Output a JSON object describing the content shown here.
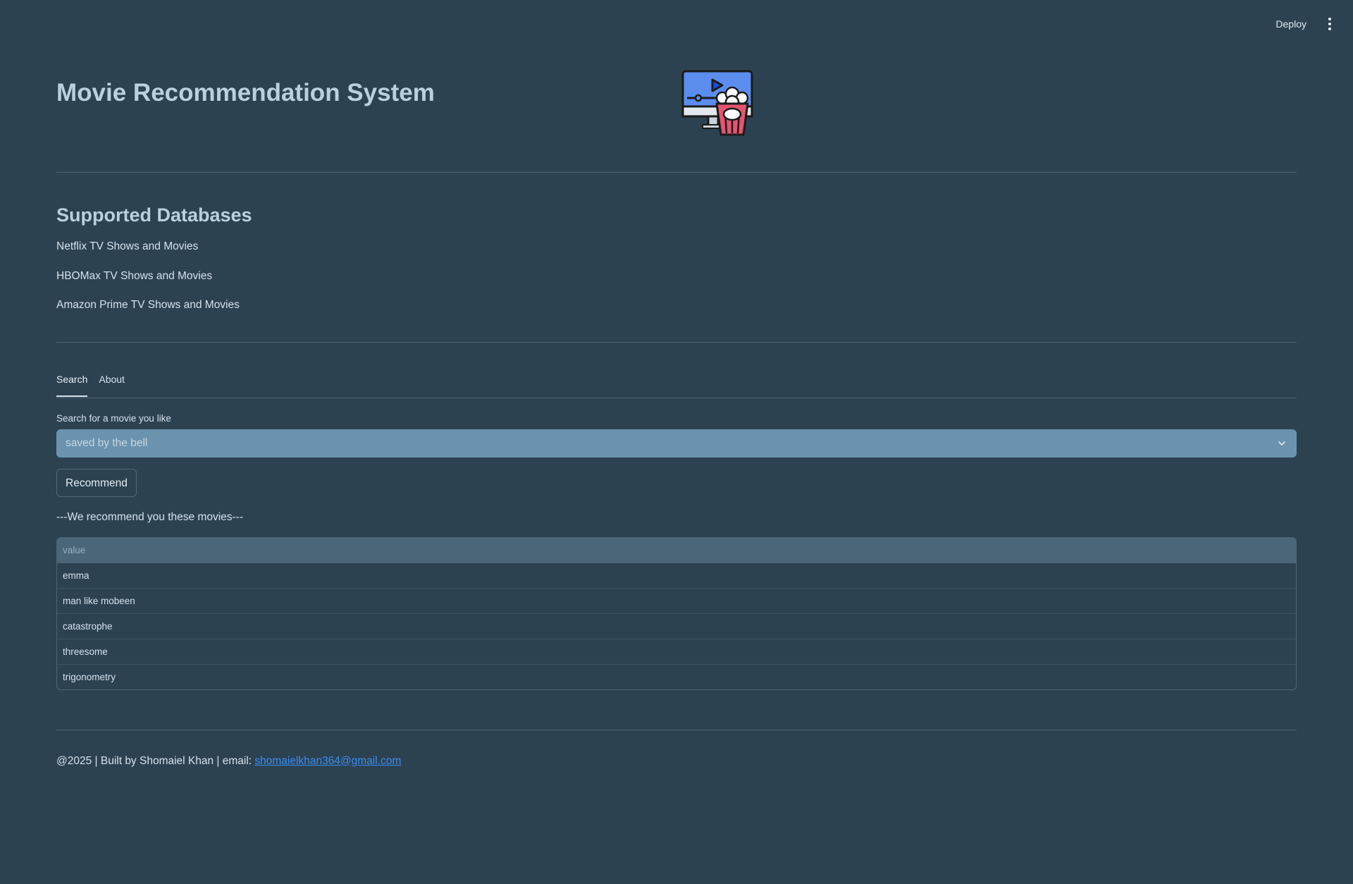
{
  "topbar": {
    "deploy_label": "Deploy",
    "menu_icon": "kebab-menu-icon"
  },
  "header": {
    "title": "Movie Recommendation System",
    "logo_icon": "movie-popcorn-logo"
  },
  "databases": {
    "title": "Supported Databases",
    "items": [
      "Netflix TV Shows and Movies",
      "HBOMax TV Shows and Movies",
      "Amazon Prime TV Shows and Movies"
    ]
  },
  "tabs": [
    {
      "label": "Search",
      "active": true
    },
    {
      "label": "About",
      "active": false
    }
  ],
  "search": {
    "label": "Search for a movie you like",
    "selected_value": "saved by the bell",
    "chevron_icon": "chevron-down-icon"
  },
  "recommend_button": "Recommend",
  "results": {
    "heading": "---We recommend you these movies---",
    "column_header": "value",
    "rows": [
      "emma",
      "man like mobeen",
      "catastrophe",
      "threesome",
      "trigonometry"
    ]
  },
  "footer": {
    "text": "@2025 | Built by Shomaiel Khan | email: ",
    "email": "shomaielkhan364@gmail.com"
  },
  "colors": {
    "background": "#2c4251",
    "select_bg": "#6b93ae",
    "table_header_bg": "#4a6678",
    "link": "#3b8ef0"
  }
}
